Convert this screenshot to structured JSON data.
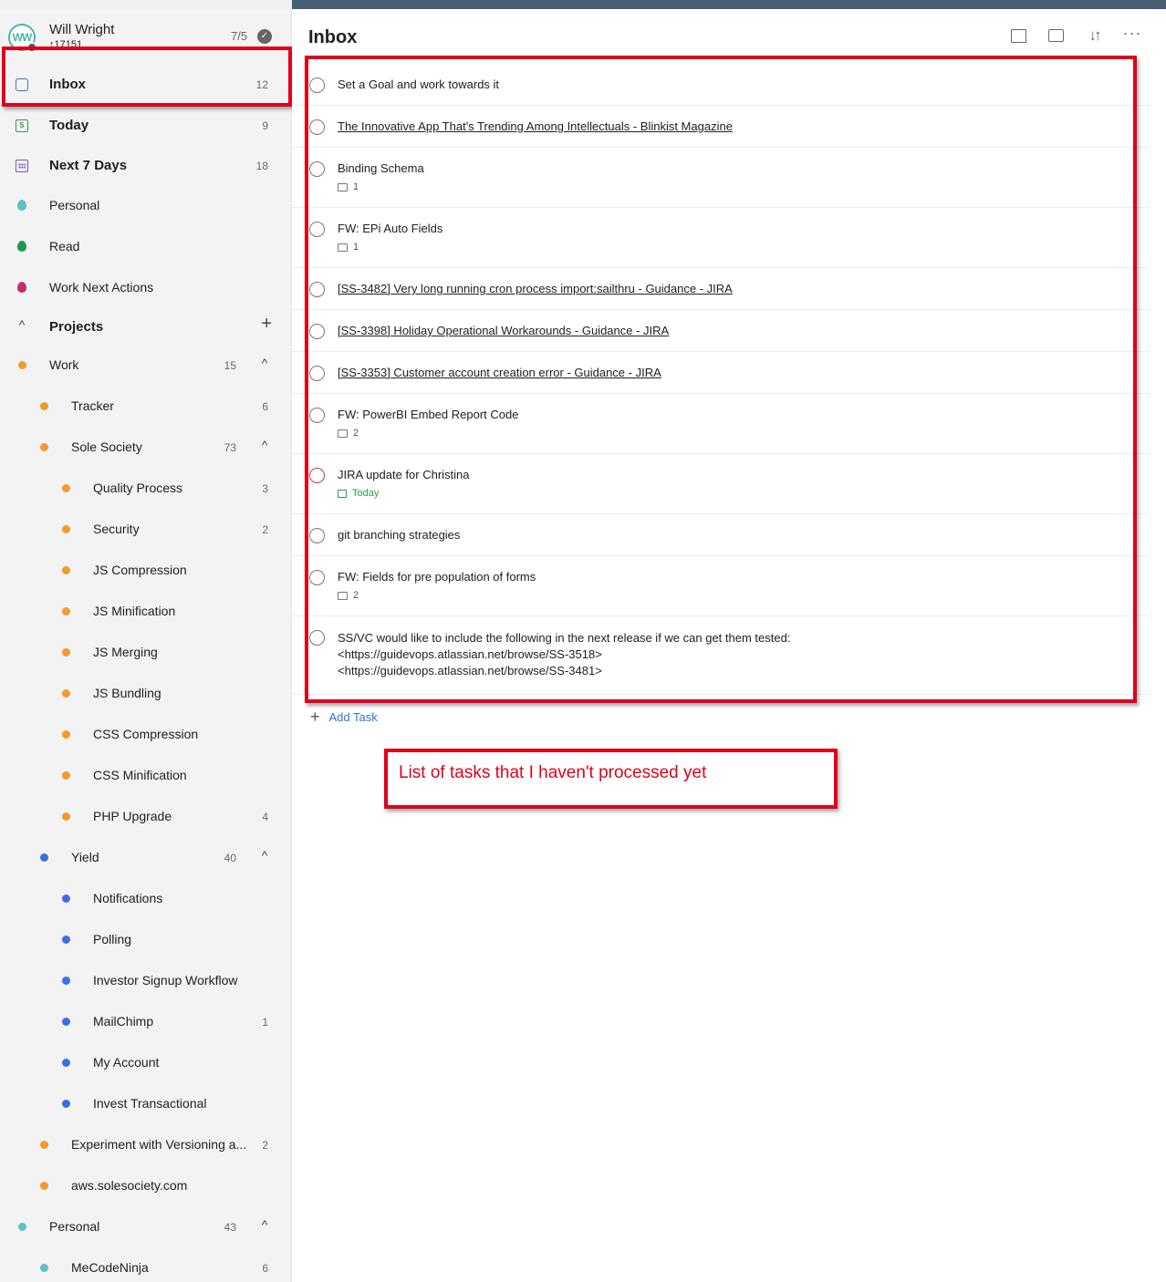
{
  "user": {
    "initials": "WW",
    "name": "Will Wright",
    "score": "↑17151",
    "ratio": "7/5"
  },
  "nav": {
    "inbox": {
      "label": "Inbox",
      "count": "12"
    },
    "today": {
      "label": "Today",
      "count": "9",
      "icon_text": "5"
    },
    "next7": {
      "label": "Next 7 Days",
      "count": "18"
    }
  },
  "filters": [
    {
      "label": "Personal",
      "color": "#5bc4be"
    },
    {
      "label": "Read",
      "color": "#1f9a4a"
    },
    {
      "label": "Work Next Actions",
      "color": "#b8336a"
    }
  ],
  "projects_header": {
    "label": "Projects",
    "chevron": "^",
    "add": "+"
  },
  "projects": [
    {
      "label": "Work",
      "count": "15",
      "level": 0,
      "color": "#f39a2b",
      "expanded": true
    },
    {
      "label": "Tracker",
      "count": "6",
      "level": 1,
      "color": "#f39a2b"
    },
    {
      "label": "Sole Society",
      "count": "73",
      "level": 1,
      "color": "#f39a2b",
      "expanded": true
    },
    {
      "label": "Quality Process",
      "count": "3",
      "level": 2,
      "color": "#f39a2b"
    },
    {
      "label": "Security",
      "count": "2",
      "level": 2,
      "color": "#f39a2b"
    },
    {
      "label": "JS Compression",
      "count": "",
      "level": 2,
      "color": "#f39a2b"
    },
    {
      "label": "JS Minification",
      "count": "",
      "level": 2,
      "color": "#f39a2b"
    },
    {
      "label": "JS Merging",
      "count": "",
      "level": 2,
      "color": "#f39a2b"
    },
    {
      "label": "JS Bundling",
      "count": "",
      "level": 2,
      "color": "#f39a2b"
    },
    {
      "label": "CSS Compression",
      "count": "",
      "level": 2,
      "color": "#f39a2b"
    },
    {
      "label": "CSS Minification",
      "count": "",
      "level": 2,
      "color": "#f39a2b"
    },
    {
      "label": "PHP Upgrade",
      "count": "4",
      "level": 2,
      "color": "#f39a2b"
    },
    {
      "label": "Yield",
      "count": "40",
      "level": 1,
      "color": "#3b6fe0",
      "expanded": true
    },
    {
      "label": "Notifications",
      "count": "",
      "level": 2,
      "color": "#3b6fe0"
    },
    {
      "label": "Polling",
      "count": "",
      "level": 2,
      "color": "#3b6fe0"
    },
    {
      "label": "Investor Signup Workflow",
      "count": "",
      "level": 2,
      "color": "#3b6fe0"
    },
    {
      "label": "MailChimp",
      "count": "1",
      "level": 2,
      "color": "#3b6fe0"
    },
    {
      "label": "My Account",
      "count": "",
      "level": 2,
      "color": "#3b6fe0"
    },
    {
      "label": "Invest Transactional",
      "count": "",
      "level": 2,
      "color": "#3b6fe0"
    },
    {
      "label": "Experiment with Versioning a...",
      "count": "2",
      "level": 1,
      "color": "#f39a2b"
    },
    {
      "label": "aws.solesociety.com",
      "count": "",
      "level": 1,
      "color": "#f39a2b"
    },
    {
      "label": "Personal",
      "count": "43",
      "level": 0,
      "color": "#5bc4be",
      "expanded": true
    },
    {
      "label": "MeCodeNinja",
      "count": "6",
      "level": 1,
      "color": "#5bc4be"
    }
  ],
  "main": {
    "title": "Inbox",
    "add_task": "Add Task",
    "tasks": [
      {
        "title": "Set a Goal and work towards it",
        "link": false,
        "meta": "",
        "meta_type": ""
      },
      {
        "title": "The Innovative App That's Trending Among Intellectuals - Blinkist Magazine",
        "link": true,
        "meta": "",
        "meta_type": ""
      },
      {
        "title": "Binding Schema",
        "link": false,
        "meta": "1",
        "meta_type": "comment"
      },
      {
        "title": "FW: EPi Auto Fields",
        "link": false,
        "meta": "1",
        "meta_type": "comment"
      },
      {
        "title": "[SS-3482] Very long running cron process import:sailthru - Guidance - JIRA",
        "link": true,
        "meta": "",
        "meta_type": ""
      },
      {
        "title": "[SS-3398] Holiday Operational Workarounds - Guidance - JIRA",
        "link": true,
        "meta": "",
        "meta_type": ""
      },
      {
        "title": "[SS-3353] Customer account creation error - Guidance - JIRA",
        "link": true,
        "meta": "",
        "meta_type": ""
      },
      {
        "title": "FW: PowerBI Embed Report Code",
        "link": false,
        "meta": "2",
        "meta_type": "comment"
      },
      {
        "title": "JIRA update for Christina",
        "link": false,
        "meta": "Today",
        "meta_type": "date",
        "priority": "red"
      },
      {
        "title": "git branching strategies",
        "link": false,
        "meta": "",
        "meta_type": ""
      },
      {
        "title": "FW: Fields for pre population of forms",
        "link": false,
        "meta": "2",
        "meta_type": "comment"
      },
      {
        "title": "SS/VC would like to include the following in the next release if we can get them tested:\n<https://guidevops.atlassian.net/browse/SS-3518>\n<https://guidevops.atlassian.net/browse/SS-3481>",
        "link": false,
        "meta": "",
        "meta_type": "",
        "multiline": true
      }
    ]
  },
  "annotation": {
    "callout": "List of tasks that I haven't processed yet",
    "color": "#e0001b"
  }
}
